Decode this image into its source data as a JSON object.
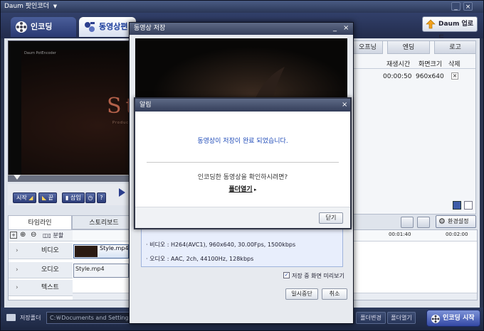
{
  "app": {
    "title": "Daum 팟인코더",
    "title_arrow": "▼"
  },
  "tabs": {
    "encoding": "인코딩",
    "video_edit": "동영상편",
    "upload": "Daum 업로드"
  },
  "right_panel": {
    "tabs": [
      "오프닝",
      "엔딩",
      "로고"
    ],
    "headers": {
      "duration": "재생시간",
      "size": "화면크기",
      "delete": "삭제"
    },
    "row": {
      "duration": "00:00:50",
      "size": "960x640",
      "delete": "×"
    }
  },
  "preview": {
    "logo": "Daum PotEncoder",
    "big_text": "St",
    "sub_text": "Product Des"
  },
  "controls": {
    "start": "시작",
    "end": "끝",
    "insert": "삽입",
    "help": "?"
  },
  "bottom": {
    "tab_timeline": "타임라인",
    "tab_storyboard": "스토리보드",
    "split": "분할",
    "settings": "환경설정",
    "time_1": "00:01:40",
    "time_2": "00:02:00",
    "tracks": [
      "비디오",
      "오디오",
      "텍스트"
    ],
    "video_clip": "Style.mp4",
    "audio_clip": "Style.mp4"
  },
  "status": {
    "label": "저장폴더",
    "path": "C:￦Documents and Settings￦Administrator￦My Documents￦Daum￦PotEncoder",
    "change": "폴더변경",
    "open": "폴더열기",
    "start": "인코딩 시작"
  },
  "save_dialog": {
    "title": "동영상 저장",
    "info_video": "· 비디오 : H264(AVC1), 960x640, 30.00Fps, 1500kbps",
    "info_audio": "· 오디오 : AAC, 2ch, 44100Hz, 128kbps",
    "preview_checkbox": "저장 중 화면 미리보기",
    "pause": "일시중단",
    "cancel": "취소"
  },
  "alert": {
    "title": "알림",
    "message": "동영상이 저장이 완료 되었습니다.",
    "question": "인코딩한 동영상을 확인하시려면?",
    "open_folder": "폴더열기",
    "close": "닫기"
  }
}
